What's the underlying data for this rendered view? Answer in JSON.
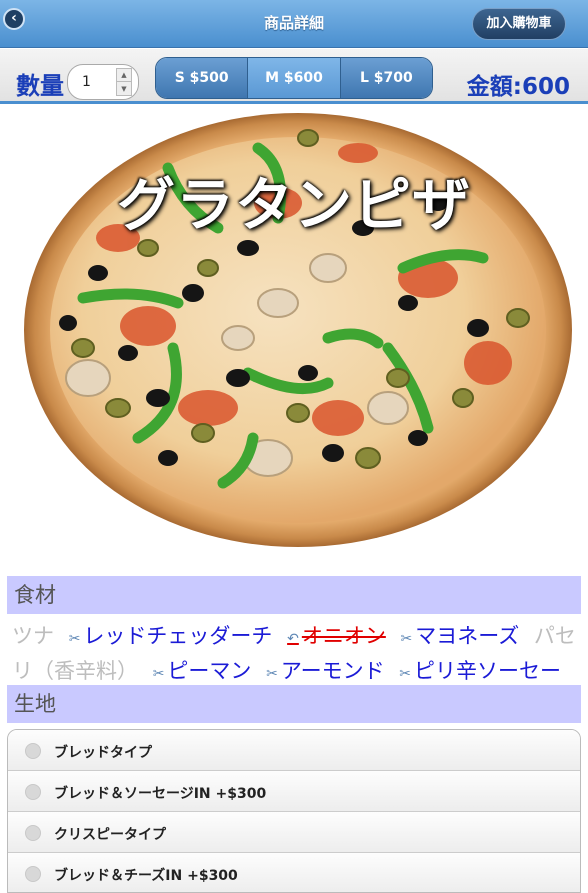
{
  "header": {
    "title": "商品詳細",
    "back_icon": "chevron-left-icon",
    "cart_label": "加入購物車"
  },
  "toolbar": {
    "qty_label": "數量",
    "qty_value": "1",
    "sizes": [
      {
        "label": "S $500"
      },
      {
        "label": "M $600"
      },
      {
        "label": "L $700"
      }
    ],
    "selected_size": "M $600",
    "total": "金額:600"
  },
  "product": {
    "title": "グラタンピザ"
  },
  "ingredients": {
    "heading": "食材",
    "items": [
      {
        "label": "ツナ",
        "state": "off"
      },
      {
        "label": "レッドチェッダーチ",
        "state": "on",
        "icon": "scissors-icon"
      },
      {
        "label": "オニオン",
        "state": "removed",
        "icon": "undo-icon"
      },
      {
        "label": "マヨネーズ",
        "state": "on",
        "icon": "scissors-icon"
      },
      {
        "label": "パセリ（香辛料）",
        "state": "off"
      },
      {
        "label": "ピーマン",
        "state": "on",
        "icon": "scissors-icon"
      },
      {
        "label": "アーモンド",
        "state": "on",
        "icon": "scissors-icon"
      },
      {
        "label": "ピリ辛ソーセージ",
        "state": "on",
        "icon": "scissors-icon"
      }
    ]
  },
  "dough": {
    "heading": "生地",
    "options": [
      {
        "label": "ブレッドタイプ"
      },
      {
        "label": "ブレッド＆ソーセージIN +$300"
      },
      {
        "label": "クリスピータイプ"
      },
      {
        "label": "ブレッド＆チーズIN +$300"
      }
    ]
  },
  "colors": {
    "header_blue": "#4a8fcf",
    "accent_text": "#1b3fb8",
    "section_bg": "#c9c9ff",
    "removed_red": "#e00000"
  }
}
